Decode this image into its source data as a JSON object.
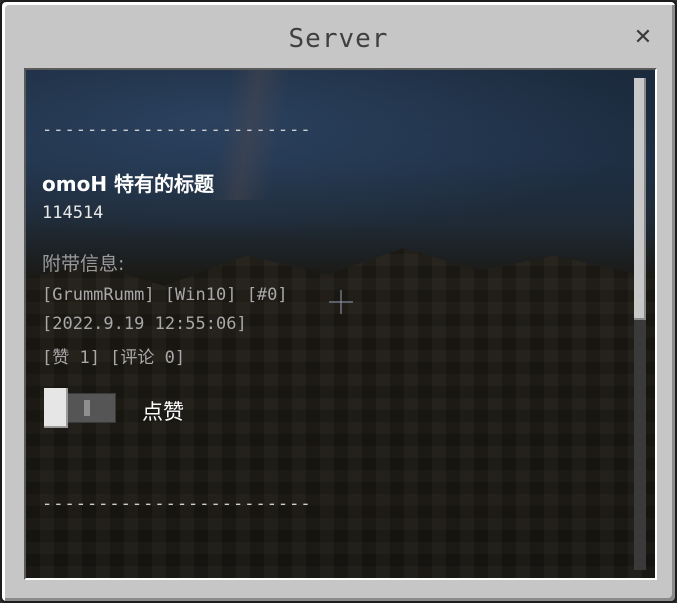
{
  "window": {
    "title": "Server",
    "close_label": "✕"
  },
  "post": {
    "divider_top": "------------------------",
    "title": "omoH 特有的标题",
    "id": "114514",
    "info_heading": "附带信息:",
    "meta_line": "[GrummRumm] [Win10] [#0]",
    "timestamp_line": "[2022.9.19 12:55:06]",
    "stats_line": "[赞 1] [评论 0]",
    "like_label": "点赞",
    "like_toggle_on": false,
    "divider_bottom": "------------------------"
  },
  "scrollbar": {
    "position": 0
  }
}
